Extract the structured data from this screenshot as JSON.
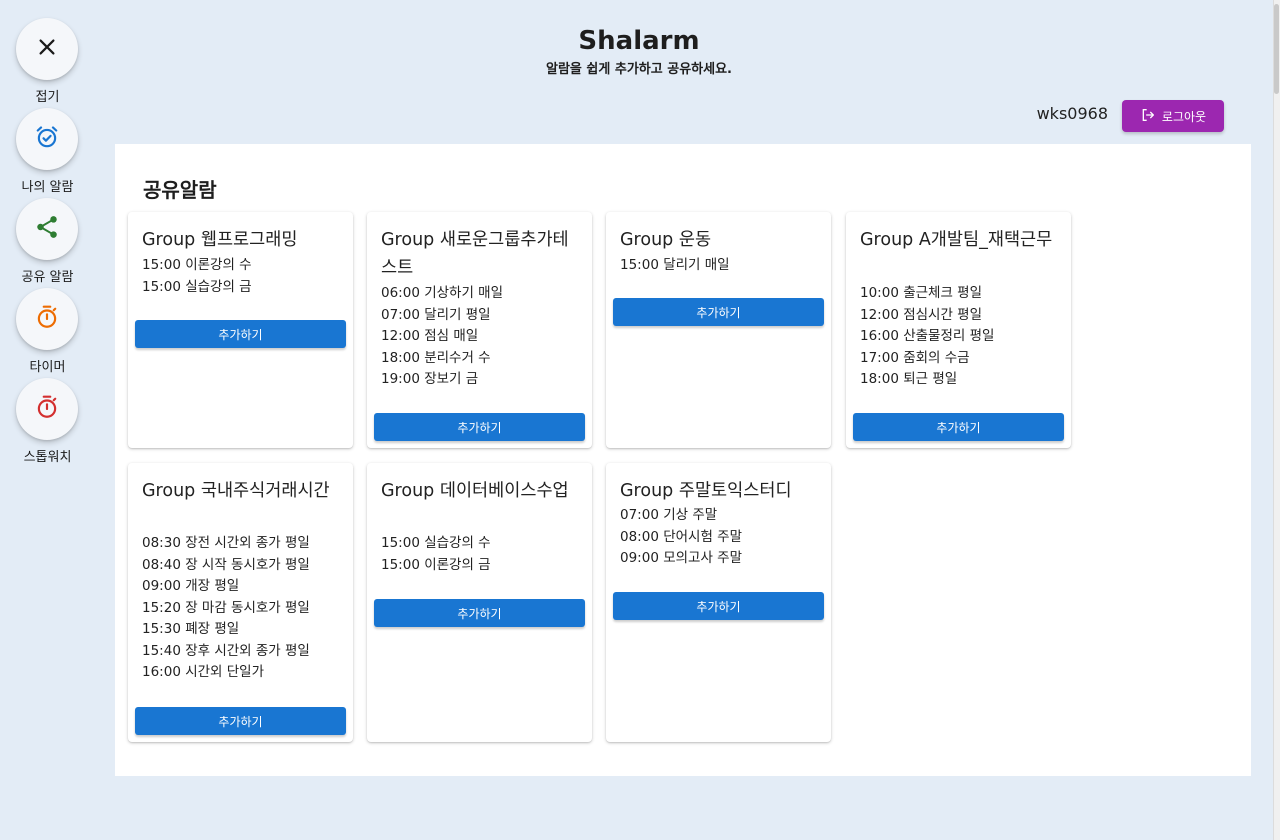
{
  "header": {
    "title": "Shalarm",
    "subtitle": "알람을 쉽게 추가하고 공유하세요."
  },
  "user": {
    "username": "wks0968",
    "logout_label": "로그아웃"
  },
  "sidebar": {
    "items": [
      {
        "label": "접기",
        "icon": "close-icon",
        "color": "#1a1a1a"
      },
      {
        "label": "나의 알람",
        "icon": "alarm-check-icon",
        "color": "#1976d2"
      },
      {
        "label": "공유 알람",
        "icon": "share-icon",
        "color": "#2e7d32"
      },
      {
        "label": "타이머",
        "icon": "timer-icon",
        "color": "#ed6c02"
      },
      {
        "label": "스톱워치",
        "icon": "stopwatch-icon",
        "color": "#d32f2f"
      }
    ]
  },
  "main": {
    "title": "공유알람",
    "add_label": "추가하기",
    "groups": [
      {
        "title": "Group 웹프로그래밍",
        "items": [
          "15:00 이론강의 수",
          "15:00 실습강의 금"
        ]
      },
      {
        "title": "Group 새로운그룹추가테스트",
        "items": [
          "06:00 기상하기 매일",
          "07:00 달리기 평일",
          "12:00 점심 매일",
          "18:00 분리수거 수",
          "19:00 장보기 금"
        ]
      },
      {
        "title": "Group 운동",
        "items": [
          "15:00 달리기 매일"
        ]
      },
      {
        "title": "Group A개발팀_재택근무",
        "items": [
          "10:00 출근체크 평일",
          "12:00 점심시간 평일",
          "16:00 산출물정리 평일",
          "17:00 줌회의 수금",
          "18:00 퇴근 평일"
        ]
      },
      {
        "title": "Group 국내주식거래시간",
        "items": [
          "08:30 장전 시간외 종가 평일",
          "08:40 장 시작 동시호가 평일",
          "09:00 개장 평일",
          "15:20 장 마감 동시호가 평일",
          "15:30 폐장 평일",
          "15:40 장후 시간외 종가 평일",
          "16:00 시간외 단일가"
        ]
      },
      {
        "title": "Group 데이터베이스수업",
        "items": [
          "15:00 실습강의 수",
          "15:00 이론강의 금"
        ]
      },
      {
        "title": "Group 주말토익스터디",
        "items": [
          "07:00 기상 주말",
          "08:00 단어시험 주말",
          "09:00 모의고사 주말"
        ]
      }
    ]
  },
  "colors": {
    "background": "#e3ecf6",
    "primary": "#1976d2",
    "logout": "#9c27b0"
  }
}
